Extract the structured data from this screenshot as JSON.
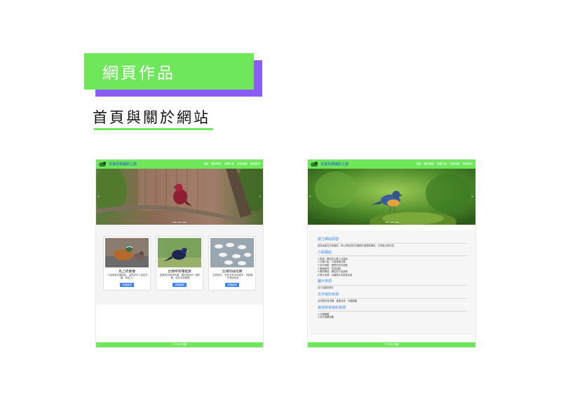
{
  "slide": {
    "title": "網頁作品",
    "subtitle": "首頁與關於網站"
  },
  "site": {
    "name": "花蓮鳥類攝影之旅",
    "nav": [
      "首頁",
      "關於網站",
      "鳥類介紹",
      "賞鳥地點",
      "聯絡我們"
    ],
    "footer": "©2020 鳥類"
  },
  "home": {
    "cards": [
      {
        "title": "鳥上的鴛鴦",
        "desc": "介紹鴛鴦鳥類特色，這是書中介紹的鳥類，特色之一",
        "button": "詳細說明"
      },
      {
        "title": "台灣特有種藍鵲",
        "desc": "藍鵲是台灣特有種，屬於鴉科的一種鳥類，色彩非常鮮豔",
        "button": "詳細說明"
      },
      {
        "title": "台灣的候鳥鵝",
        "desc": "這是候鳥，到冬天來台灣過冬，會群聚在濕地休息",
        "button": "詳細說明"
      }
    ]
  },
  "about": {
    "sections": [
      {
        "title": "建立網站原因",
        "lines": [
          "因為喜歡賞鳥和攝影，所以把拍到的鳥類照片整理成網站，分享給大家欣賞。"
        ]
      },
      {
        "title": "介紹網站",
        "lines": [
          "1.首頁：網站的主要入口頁面",
          "2.鳥類介紹：介紹各種鳥類",
          "3.賞鳥地點：推薦的賞鳥地點",
          "4.聯絡我們：意見回饋",
          "5.關於網站：網站的介紹說明",
          "6.照片來源：鳥類照片的來源出處"
        ]
      },
      {
        "title": "圖片來源",
        "lines": [
          "自己拍攝的照片"
        ]
      },
      {
        "title": "文字資料來源",
        "lines": [
          "台灣野鳥資訊網、維基百科、鳥類圖鑑"
        ]
      },
      {
        "title": "其他參考資料來源",
        "lines": [
          "1.鳥類圖鑑",
          "2.賞鳥相關書籍"
        ]
      }
    ]
  },
  "colors": {
    "accent_green": "#6ee85a",
    "accent_purple": "#8b5cf6",
    "link_blue": "#3b82f6"
  }
}
